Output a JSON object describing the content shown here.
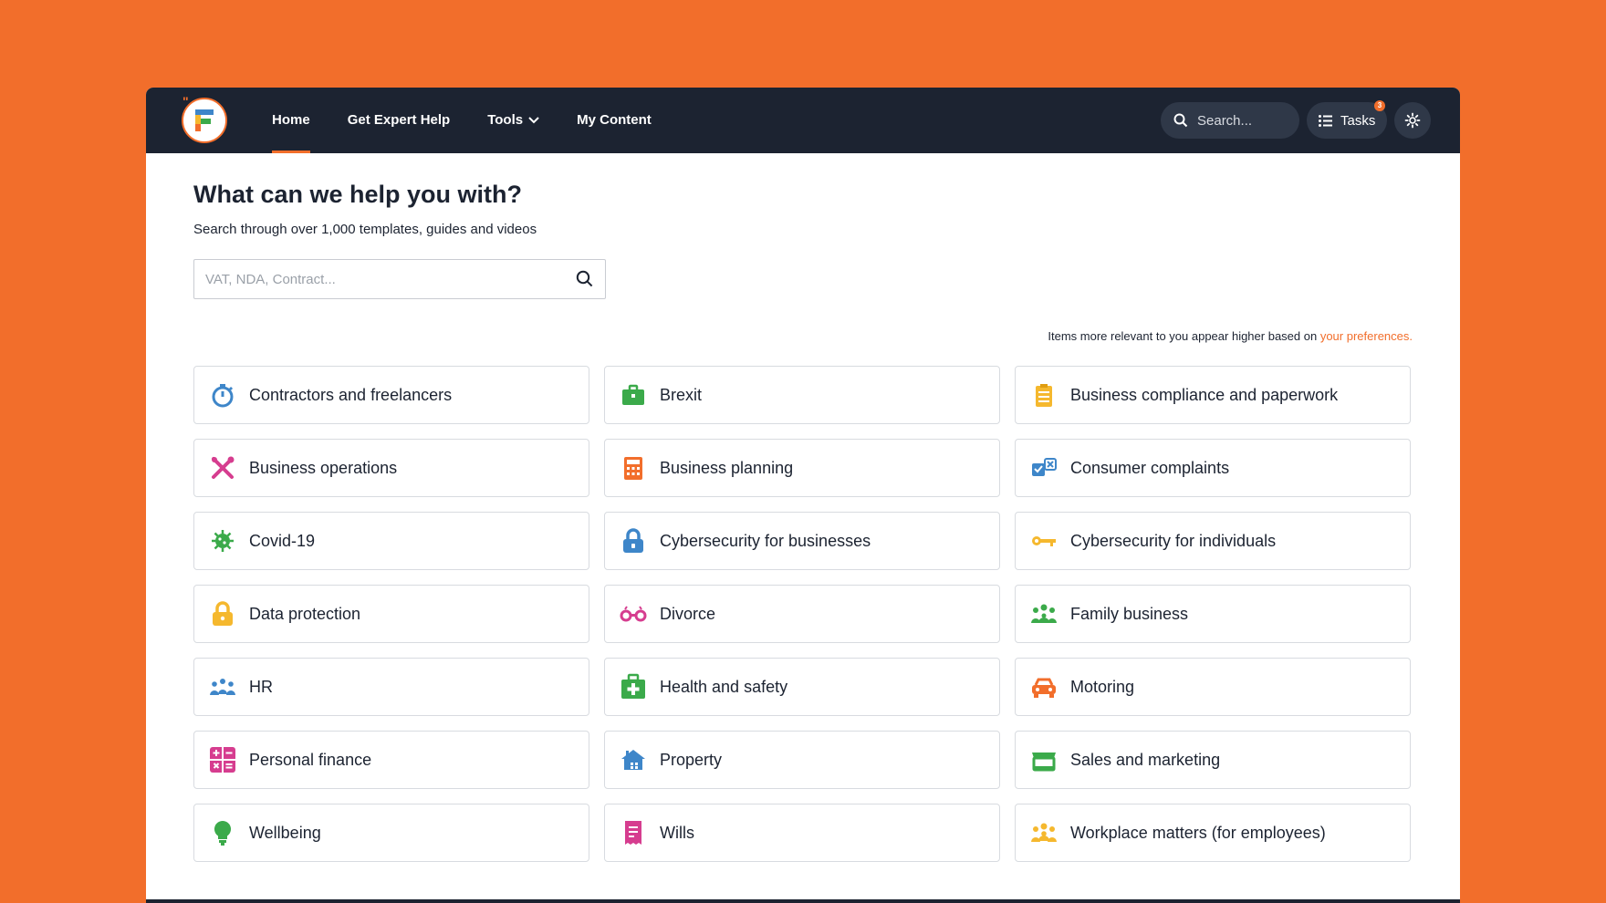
{
  "nav": {
    "home": "Home",
    "expert_help": "Get Expert Help",
    "tools": "Tools",
    "my_content": "My Content",
    "search_placeholder": "Search...",
    "tasks_label": "Tasks",
    "tasks_badge": "3"
  },
  "main": {
    "title": "What can we help you with?",
    "subtitle": "Search through over 1,000 templates, guides and videos",
    "search_placeholder": "VAT, NDA, Contract...",
    "pref_note": "Items more relevant to you appear higher based on ",
    "pref_link": "your preferences."
  },
  "categories": [
    {
      "label": "Contractors and freelancers",
      "icon": "stopwatch-icon",
      "color": "#3E86C9"
    },
    {
      "label": "Brexit",
      "icon": "briefcase-icon",
      "color": "#3BAA4A"
    },
    {
      "label": "Business compliance and paperwork",
      "icon": "clipboard-icon",
      "color": "#F5B82E"
    },
    {
      "label": "Business operations",
      "icon": "tools-icon",
      "color": "#D63D8F"
    },
    {
      "label": "Business planning",
      "icon": "calculator-icon",
      "color": "#F26E2B"
    },
    {
      "label": "Consumer complaints",
      "icon": "checkbox-icon",
      "color": "#3E86C9"
    },
    {
      "label": "Covid-19",
      "icon": "virus-icon",
      "color": "#3BAA4A"
    },
    {
      "label": "Cybersecurity for businesses",
      "icon": "padlock-icon",
      "color": "#3E86C9"
    },
    {
      "label": "Cybersecurity for individuals",
      "icon": "key-icon",
      "color": "#F5B82E"
    },
    {
      "label": "Data protection",
      "icon": "lock-icon",
      "color": "#F5B82E"
    },
    {
      "label": "Divorce",
      "icon": "separated-rings-icon",
      "color": "#D63D8F"
    },
    {
      "label": "Family business",
      "icon": "family-icon",
      "color": "#3BAA4A"
    },
    {
      "label": "HR",
      "icon": "people-icon",
      "color": "#3E86C9"
    },
    {
      "label": "Health and safety",
      "icon": "first-aid-icon",
      "color": "#3BAA4A"
    },
    {
      "label": "Motoring",
      "icon": "car-icon",
      "color": "#F26E2B"
    },
    {
      "label": "Personal finance",
      "icon": "math-symbols-icon",
      "color": "#D63D8F"
    },
    {
      "label": "Property",
      "icon": "house-icon",
      "color": "#3E86C9"
    },
    {
      "label": "Sales and marketing",
      "icon": "storefront-icon",
      "color": "#3BAA4A"
    },
    {
      "label": "Wellbeing",
      "icon": "lightbulb-icon",
      "color": "#3BAA4A"
    },
    {
      "label": "Wills",
      "icon": "document-icon",
      "color": "#D63D8F"
    },
    {
      "label": "Workplace matters (for employees)",
      "icon": "group-icon",
      "color": "#F5B82E"
    }
  ]
}
